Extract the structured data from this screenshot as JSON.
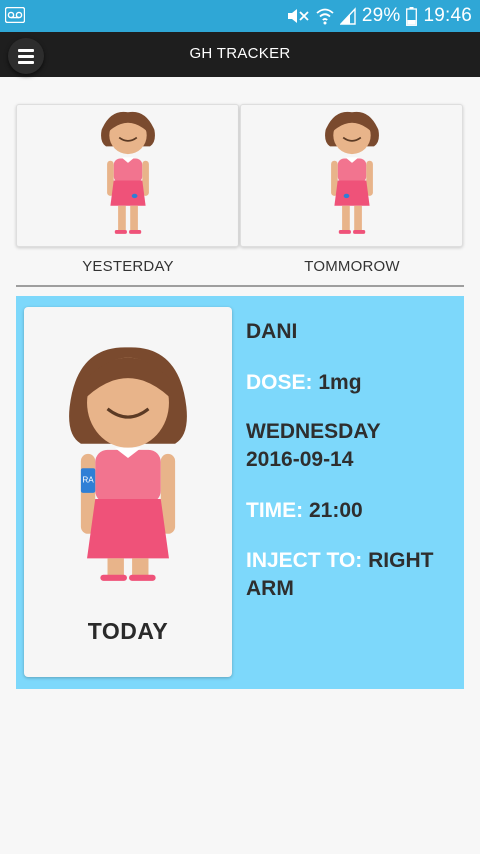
{
  "status_bar": {
    "left_icon": "voicemail-icon",
    "icons": [
      "mute-icon",
      "wifi-icon",
      "signal-icon",
      "battery-icon"
    ],
    "battery": "29%",
    "time": "19:46"
  },
  "app_bar": {
    "title": "GH TRACKER",
    "menu_icon": "menu-icon"
  },
  "days": {
    "yesterday_label": "YESTERDAY",
    "tomorrow_label": "TOMMOROW"
  },
  "today": {
    "label": "TODAY",
    "badge": "RA",
    "name": "DANI",
    "dose_key": "DOSE:",
    "dose_value": "1mg",
    "day": "WEDNESDAY",
    "date": "2016-09-14",
    "time_key": "TIME:",
    "time_value": "21:00",
    "inject_key": "INJECT TO:",
    "inject_value": "RIGHT ARM"
  },
  "colors": {
    "status_bar": "#2fa7d6",
    "app_bar": "#1e1e1e",
    "today_panel": "#7dd8fb",
    "hair": "#7a4a2e",
    "dress": "#ef5279",
    "skin": "#e8b48a"
  }
}
